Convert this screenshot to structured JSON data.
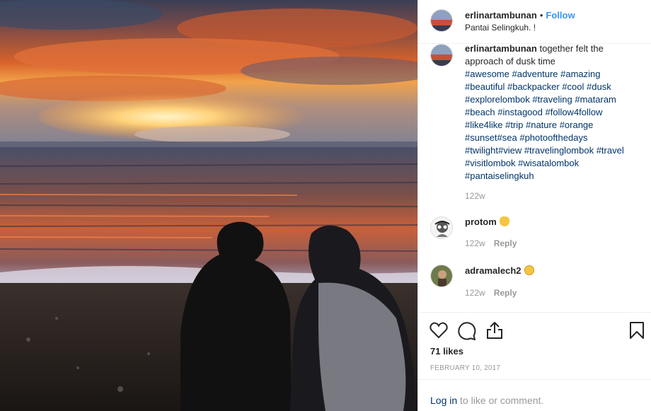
{
  "post": {
    "username": "erlinartambunan",
    "separator": "•",
    "follow_label": "Follow",
    "location": "Pantai Selingkuh. !"
  },
  "caption": {
    "username": "erlinartambunan",
    "text": " together felt the approach of dusk time",
    "hashtags": "#awesome #adventure #amazing #beautiful #backpacker #cool #dusk #explorelombok #traveling #mataram #beach #instagood #follow4follow #like4like #trip #nature #orange #sunset#sea #photoofthedays #twilight#view #travelinglombok #travel #visitlombok #wisatalombok #pantaiselingkuh",
    "time": "122w"
  },
  "comments": [
    {
      "username": "protom",
      "emoji": "ok-hand-emoji",
      "time": "122w",
      "reply_label": "Reply"
    },
    {
      "username": "adramalech2",
      "emoji": "grinning-face-emoji",
      "time": "122w",
      "reply_label": "Reply"
    }
  ],
  "actions": {
    "icons": [
      "heart-icon",
      "comment-icon",
      "share-icon",
      "bookmark-icon"
    ],
    "likes": "71 likes",
    "date": "FEBRUARY 10, 2017"
  },
  "login": {
    "link_label": "Log in",
    "rest_label": " to like or comment."
  },
  "colors": {
    "follow": "#3897f0",
    "hashtag": "#003569",
    "muted": "#999999"
  }
}
